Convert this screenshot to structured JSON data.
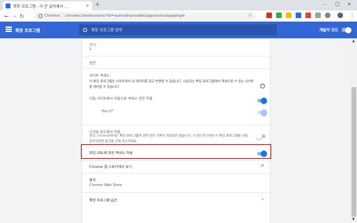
{
  "browser": {
    "tab_title": "확장 프로그램 - 더 큰 글자에서 ...",
    "tab_close": "×",
    "new_tab": "+",
    "window_controls": [
      "–",
      "▢",
      "×"
    ],
    "omnibox_label": "Chrome",
    "omnibox_separator": "|",
    "url": "chrome://extensions/?id=oumnjfnpceddkclpgomclncbpojehgie",
    "star": "☆",
    "menu": "⋮"
  },
  "header": {
    "title": "확장 프로그램",
    "search_placeholder": "확장 프로그램 검색",
    "devmode_label": "개발자 모드"
  },
  "details": {
    "size_label": "크기",
    "size_value": "1",
    "permissions_label": "권한",
    "site_access": {
      "title": "사이트 액세스",
      "description": "이 확장 프로그램은 사이트에서 내 데이터를 읽고 변경할 수 있습니다. 사용자는 확장 프로그램에서 액세스할 수 있는 사이트를 제어할 수 있습니다.",
      "help": "?"
    },
    "auto_allow": {
      "label": "다음 사이트에서 자동으로 액세스 권한 허용",
      "site": "file:///*"
    },
    "incognito": {
      "title": "시크릿 모드에서 허용",
      "description": "경고: Chrome에서는 확장 프로그램에 관한 방문 기록이 저장되지 않습니다. 시크릿 모드에서 이 확장 프로그램을 사용 중지하려면 옵션을 선택 취소하세요."
    },
    "file_urls": {
      "label": "파일 URL에 대한 액세스 허용"
    },
    "webstore": {
      "label": "Chrome 웹 스토어에서 보기",
      "icon": "↗"
    },
    "source": {
      "label": "출처",
      "value": "Chrome Web Store"
    },
    "options": {
      "label": "확장 프로그램 옵션",
      "arrow": "›"
    }
  },
  "scrollbar": {
    "up": "▲",
    "down": "▼"
  },
  "colors": {
    "header": "#3367d6",
    "toggle_on": "#1a73e8",
    "highlight": "#e00000"
  },
  "toggles": {
    "devmode": false,
    "auto_allow": true,
    "file_site": true,
    "incognito": false,
    "file_urls": true
  }
}
